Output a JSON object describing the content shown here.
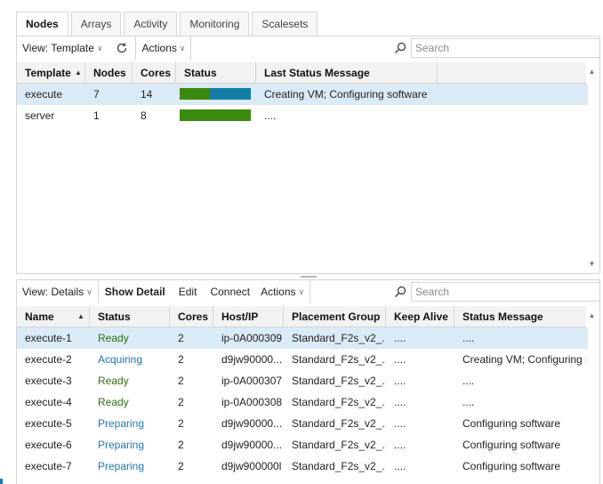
{
  "tabs": [
    "Nodes",
    "Arrays",
    "Activity",
    "Monitoring",
    "Scalesets"
  ],
  "top": {
    "view_label": "View: Template",
    "actions_label": "Actions",
    "search_placeholder": "Search",
    "columns": [
      "Template",
      "Nodes",
      "Cores",
      "Status",
      "Last Status Message"
    ],
    "rows": [
      {
        "template": "execute",
        "nodes": "7",
        "cores": "14",
        "status_fill": [
          0.43,
          0.57
        ],
        "message": "Creating VM; Configuring software"
      },
      {
        "template": "server",
        "nodes": "1",
        "cores": "8",
        "status_fill": [
          1.0,
          0.0
        ],
        "message": "...."
      }
    ]
  },
  "bottom": {
    "view_label": "View: Details",
    "show_detail": "Show Detail",
    "edit": "Edit",
    "connect": "Connect",
    "actions_label": "Actions",
    "search_placeholder": "Search",
    "columns": [
      "Name",
      "Status",
      "Cores",
      "Host/IP",
      "Placement Group",
      "Keep Alive",
      "Status Message"
    ],
    "rows": [
      {
        "name": "execute-1",
        "status": "Ready",
        "cores": "2",
        "host": "ip-0A000309",
        "pg": "Standard_F2s_v2_...",
        "keep": "....",
        "msg": "...."
      },
      {
        "name": "execute-2",
        "status": "Acquiring",
        "cores": "2",
        "host": "d9jw90000...",
        "pg": "Standard_F2s_v2_...",
        "keep": "....",
        "msg": "Creating VM; Configuring s..."
      },
      {
        "name": "execute-3",
        "status": "Ready",
        "cores": "2",
        "host": "ip-0A000307",
        "pg": "Standard_F2s_v2_...",
        "keep": "....",
        "msg": "...."
      },
      {
        "name": "execute-4",
        "status": "Ready",
        "cores": "2",
        "host": "ip-0A000308",
        "pg": "Standard_F2s_v2_...",
        "keep": "....",
        "msg": "...."
      },
      {
        "name": "execute-5",
        "status": "Preparing",
        "cores": "2",
        "host": "d9jw90000...",
        "pg": "Standard_F2s_v2_...",
        "keep": "....",
        "msg": "Configuring software"
      },
      {
        "name": "execute-6",
        "status": "Preparing",
        "cores": "2",
        "host": "d9jw90000...",
        "pg": "Standard_F2s_v2_...",
        "keep": "....",
        "msg": "Configuring software"
      },
      {
        "name": "execute-7",
        "status": "Preparing",
        "cores": "2",
        "host": "d9jw900000l",
        "pg": "Standard_F2s_v2_...",
        "keep": "....",
        "msg": "Configuring software"
      }
    ]
  },
  "colors": {
    "ready": "#2f6f14",
    "acquiring": "#1e78b4",
    "preparing": "#1e78b4",
    "status_green": "#3b8a0f",
    "status_teal": "#137fa2",
    "selection": "#dbeaf7"
  },
  "icons": {
    "refresh": "refresh-icon",
    "search": "search-icon",
    "sort": "sort-ascending-icon",
    "scroll_up": "scroll-up-icon",
    "scroll_down": "scroll-down-icon"
  }
}
